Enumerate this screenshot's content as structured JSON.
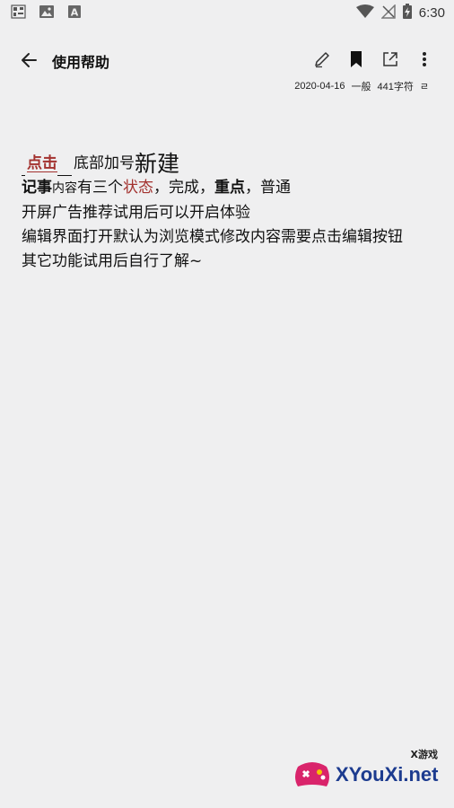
{
  "status_bar": {
    "time": "6:30",
    "icons": [
      "qr-notification-icon",
      "image-notification-icon",
      "font-notification-icon",
      "wifi-icon",
      "no-signal-icon",
      "battery-charging-icon"
    ]
  },
  "app_bar": {
    "title": "使用帮助",
    "actions": [
      "edit-icon",
      "bookmark-icon",
      "share-icon",
      "more-vert-icon"
    ]
  },
  "meta": {
    "date": "2020-04-16",
    "category": "一般",
    "char_count": "441字符",
    "extra": "ㄹ"
  },
  "content": {
    "line1": {
      "link": "点击",
      "mid": "底部加号",
      "big": "新建"
    },
    "line2": {
      "a": "记事",
      "b": "内容",
      "c": "有三个",
      "d": "状态",
      "e": "，完成，",
      "f": "重点",
      "g": "，普通"
    },
    "line3": "开屏广告推荐试用后可以开启体验",
    "line4": "编辑界面打开默认为浏览模式修改内容需要点击编辑按钮",
    "line5": "其它功能试用后自行了解~"
  },
  "watermark": {
    "small": "X游戏",
    "text": "XYouXi.net"
  }
}
